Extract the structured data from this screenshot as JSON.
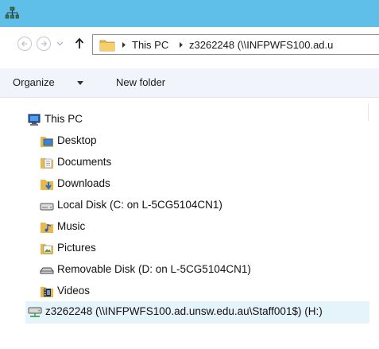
{
  "window": {
    "icon": "network-tree-icon"
  },
  "nav": {
    "back_icon": "back-arrow-icon",
    "forward_icon": "forward-arrow-icon",
    "history_icon": "chevron-down-icon",
    "up_icon": "up-arrow-icon"
  },
  "address": {
    "crumbs": [
      "This PC",
      "z3262248 (\\\\INFPWFS100.ad.u"
    ]
  },
  "command_bar": {
    "organize_label": "Organize",
    "new_folder_label": "New folder"
  },
  "tree": {
    "items": [
      {
        "label": "This PC",
        "icon": "computer-icon"
      },
      {
        "label": "Desktop",
        "icon": "desktop-folder-icon"
      },
      {
        "label": "Documents",
        "icon": "documents-folder-icon"
      },
      {
        "label": "Downloads",
        "icon": "downloads-folder-icon"
      },
      {
        "label": "Local Disk (C: on L-5CG5104CN1)",
        "icon": "disk-drive-icon"
      },
      {
        "label": "Music",
        "icon": "music-folder-icon"
      },
      {
        "label": "Pictures",
        "icon": "pictures-folder-icon"
      },
      {
        "label": "Removable Disk (D: on L-5CG5104CN1)",
        "icon": "removable-disk-icon"
      },
      {
        "label": "Videos",
        "icon": "videos-folder-icon"
      },
      {
        "label": "z3262248 (\\\\INFPWFS100.ad.unsw.edu.au\\Staff001$) (H:)",
        "icon": "network-drive-icon"
      }
    ]
  },
  "colors": {
    "titlebar": "#5fbfe9",
    "command_bar": "#f1f5fb",
    "selection": "#e5f3fb"
  }
}
